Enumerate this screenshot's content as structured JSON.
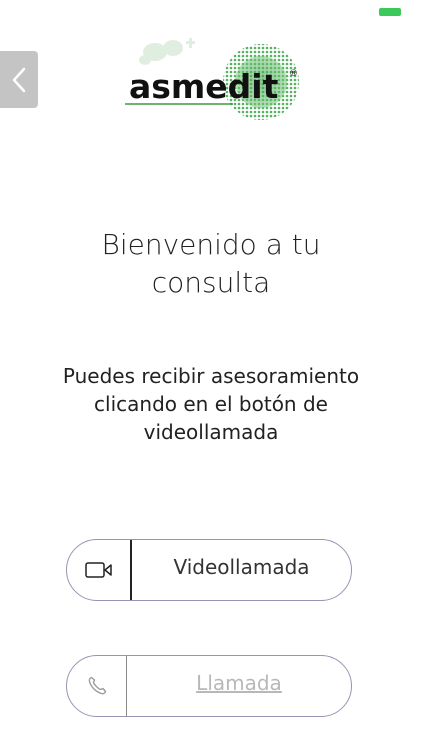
{
  "app": {
    "accent_color": "#3cc85a",
    "brand_dark": "#111111",
    "button_border_color": "#9a94b4"
  },
  "header": {
    "back_icon": "chevron-left-icon",
    "logo_text": "asmedit",
    "logo_mark": "®",
    "battery_icon": "battery-icon"
  },
  "welcome": {
    "line1": "Bienvenido a tu",
    "line2": "consulta"
  },
  "description": {
    "line1": "Puedes recibir asesoramiento",
    "line2": "clicando en el botón de",
    "line3": "videollamada"
  },
  "actions": {
    "video_label": "Videollamada",
    "video_icon": "video-camera-icon",
    "phone_label": "Llamada",
    "phone_icon": "phone-icon"
  }
}
